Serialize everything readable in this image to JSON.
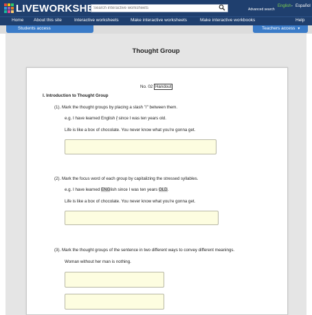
{
  "site": {
    "logo_text": "LIVEWORKSHEETS",
    "logo_colors": [
      "#e74c3c",
      "#f1c40f",
      "#2ecc71",
      "#3498db",
      "#9b59b6",
      "#e67e22",
      "#1abc9c",
      "#e84393",
      "#fdcb6e"
    ],
    "search_placeholder": "Search interactive worksheets",
    "advanced_search": "Advanced search",
    "lang_english": "English",
    "lang_separator": "-",
    "lang_spanish": "Español",
    "accent_color": "#3a7bc8",
    "header_color": "#1f3f6e"
  },
  "nav": {
    "home": "Home",
    "about": "About this site",
    "interactive": "Interactive worksheets",
    "make_ws": "Make interactive worksheets",
    "make_wb": "Make interactive workbooks",
    "help": "Help"
  },
  "access": {
    "students": "Students access",
    "teachers": "Teachers access"
  },
  "page": {
    "title": "Thought Group"
  },
  "worksheet": {
    "number": "No. 02",
    "handout": "Handout",
    "section": "I. Introduction to Thought Group",
    "q1": {
      "num": "(1).",
      "instruction": "Mark the thought groups by placing a slash \"/\" between them.",
      "example_a": "e.g. I have learned English ",
      "example_slash": "/",
      "example_b": " since I was ten years old.",
      "sentence": "Life is like a box of chocolate. You never know what you're gonna get."
    },
    "q2": {
      "num": "(2).",
      "instruction": "Mark the focus word of each group by capitalizing the stressed syllables.",
      "example_a": "e.g. I have learned ",
      "example_eng": "ENG",
      "example_b": "lish since I was ten years ",
      "example_old": "OLD",
      "example_c": ".",
      "sentence": "Life is like a box of chocolate. You never know what you're gonna get."
    },
    "q3": {
      "num": "(3).",
      "instruction": "Mark the thought groups of the sentence in two different ways to convey different meanings.",
      "sentence": "Woman without her man is nothing."
    }
  }
}
